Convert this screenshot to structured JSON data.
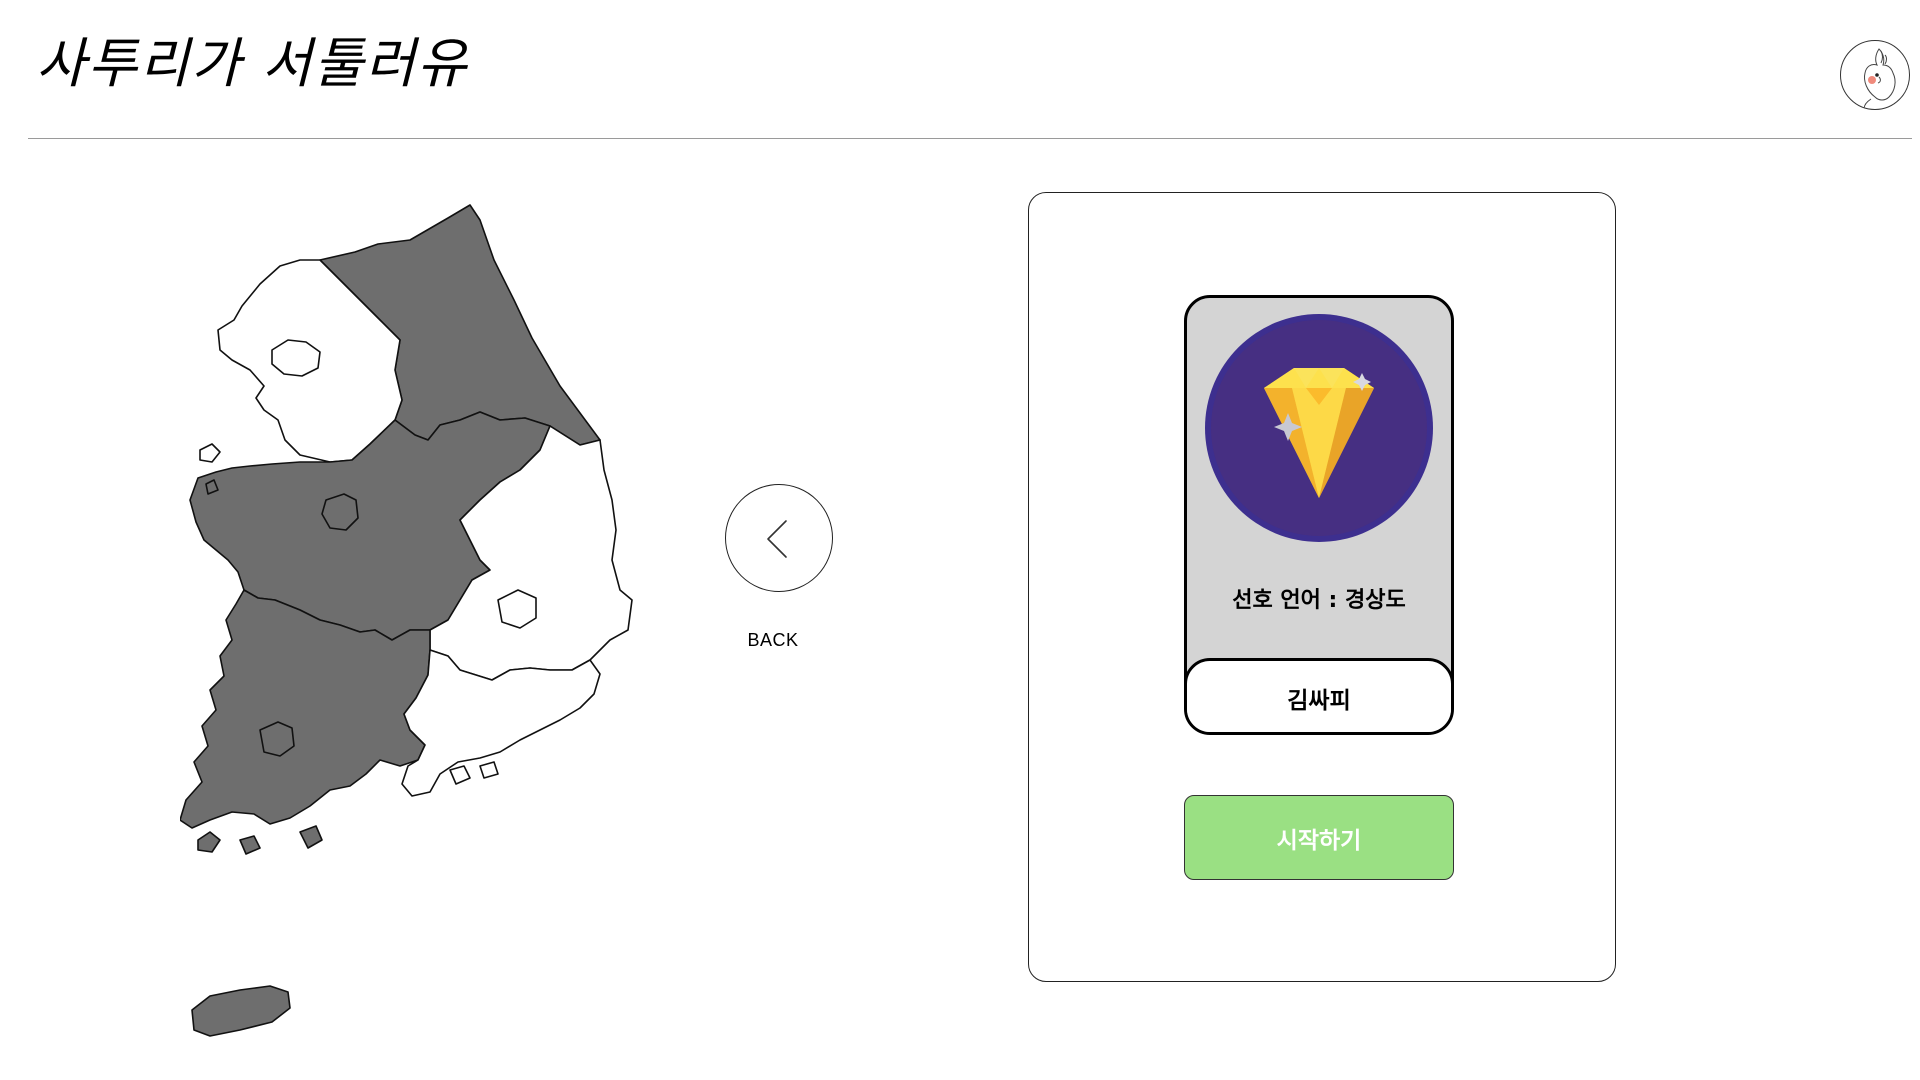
{
  "header": {
    "logo_text": "사투리가 서툴러유",
    "avatar_icon": "parrot-avatar-icon"
  },
  "map": {
    "icon": "south-korea-map",
    "selected_fill": "#6e6e6e",
    "unselected_fill": "#ffffff"
  },
  "back": {
    "label": "BACK",
    "icon": "chevron-left-icon"
  },
  "card": {
    "badge_icon": "diamond-icon",
    "preferred_language": "선호 언어 : 경상도",
    "nickname": "김싸피"
  },
  "start_button": {
    "label": "시작하기",
    "color": "#9ae083"
  }
}
